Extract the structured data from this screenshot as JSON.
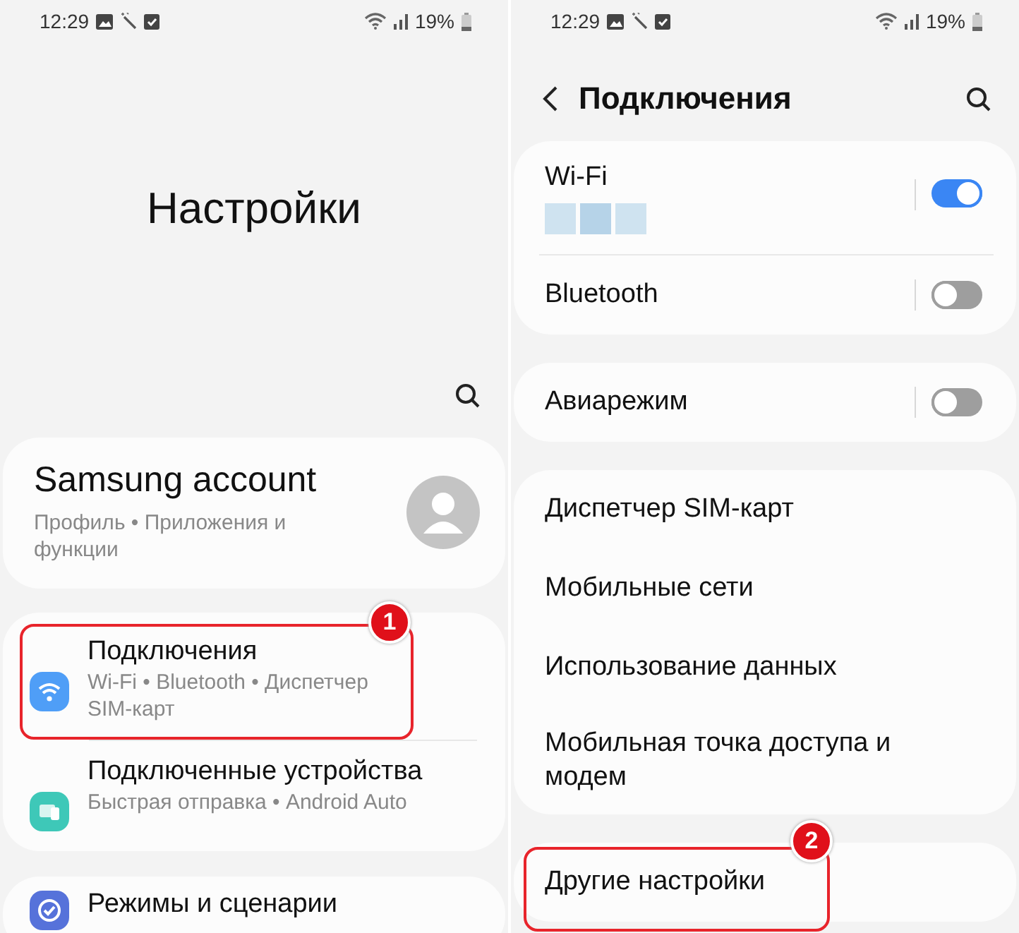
{
  "screens": [
    {
      "kind": "home",
      "status_bar": {
        "time": "12:29",
        "battery": "19%"
      },
      "title": "Настройки",
      "account": {
        "title": "Samsung account",
        "subtitle": "Профиль • Приложения и функции"
      },
      "groups": [
        {
          "items": [
            {
              "kind": "wifi",
              "title": "Подключения",
              "subtitle": "Wi-Fi • Bluetooth • Диспетчер SIM-карт",
              "annotation": "1"
            },
            {
              "kind": "devices",
              "title": "Подключенные устройства",
              "subtitle": "Быстрая отправка • Android Auto"
            }
          ]
        },
        {
          "items": [
            {
              "kind": "modes",
              "title": "Режимы и сценарии"
            }
          ]
        }
      ]
    },
    {
      "kind": "subpage",
      "status_bar": {
        "time": "12:29",
        "battery": "19%"
      },
      "title": "Подключения",
      "groups": [
        {
          "items": [
            {
              "kind": "toggle",
              "title": "Wi-Fi",
              "on": true,
              "redacted": true
            },
            {
              "kind": "toggle",
              "title": "Bluetooth",
              "on": false
            }
          ]
        },
        {
          "items": [
            {
              "kind": "toggle",
              "title": "Авиарежим",
              "on": false
            }
          ]
        },
        {
          "items": [
            {
              "kind": "link",
              "title": "Диспетчер SIM-карт"
            },
            {
              "kind": "link",
              "title": "Мобильные сети"
            },
            {
              "kind": "link",
              "title": "Использование данных"
            },
            {
              "kind": "link",
              "title": "Мобильная точка доступа и модем"
            }
          ]
        },
        {
          "items": [
            {
              "kind": "link",
              "title": "Другие настройки",
              "annotation": "2"
            }
          ]
        }
      ]
    }
  ]
}
